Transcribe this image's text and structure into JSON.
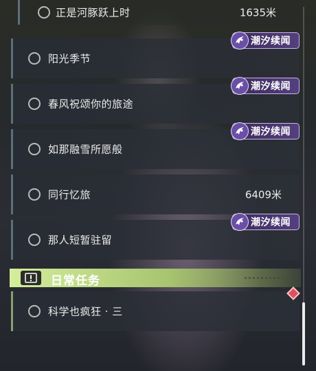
{
  "quests": [
    {
      "name": "正是河豚跃上时",
      "distance": "1635米",
      "badge": ""
    },
    {
      "name": "阳光季节",
      "distance": "",
      "badge": "潮汐续闻"
    },
    {
      "name": "春风祝颂你的旅途",
      "distance": "",
      "badge": "潮汐续闻"
    },
    {
      "name": "如那融雪所愿般",
      "distance": "",
      "badge": "潮汐续闻"
    },
    {
      "name": "同行忆旅",
      "distance": "6409米",
      "badge": ""
    },
    {
      "name": "那人短暂驻留",
      "distance": "",
      "badge": "潮汐续闻"
    }
  ],
  "daily": {
    "title": "日常任务",
    "icon": "exclamation-icon",
    "quests": [
      {
        "name": "科学也疯狂 · 三"
      }
    ]
  },
  "colors": {
    "badge_bg": "#54407e",
    "daily_accent": "#a7c46e",
    "marker": "#e24f5c"
  }
}
